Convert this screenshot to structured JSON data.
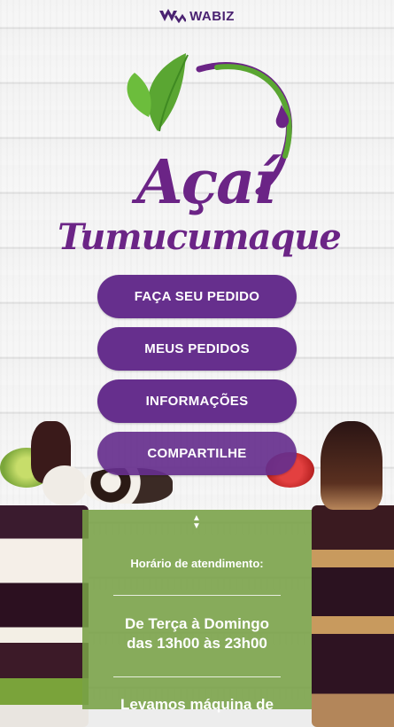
{
  "header": {
    "brand": "WABIZ",
    "icon": "wabiz-logo-icon"
  },
  "logo": {
    "word1": "Açaí",
    "word2": "Tumucumaque",
    "colors": {
      "purple": "#6b2486",
      "green": "#5aa632"
    }
  },
  "menu": {
    "items": [
      {
        "label": "FAÇA SEU PEDIDO"
      },
      {
        "label": "MEUS PEDIDOS"
      },
      {
        "label": "INFORMAÇÕES"
      },
      {
        "label": "COMPARTILHE"
      }
    ],
    "button_color": "#662f8d"
  },
  "info": {
    "hours_title": "Horário de atendimento:",
    "days": "De Terça à Domingo",
    "time": "das 13h00 às 23h00",
    "note": "Levamos máquina de",
    "panel_color": "#78a046",
    "expand_icon": "chevron-up-down-icon"
  }
}
